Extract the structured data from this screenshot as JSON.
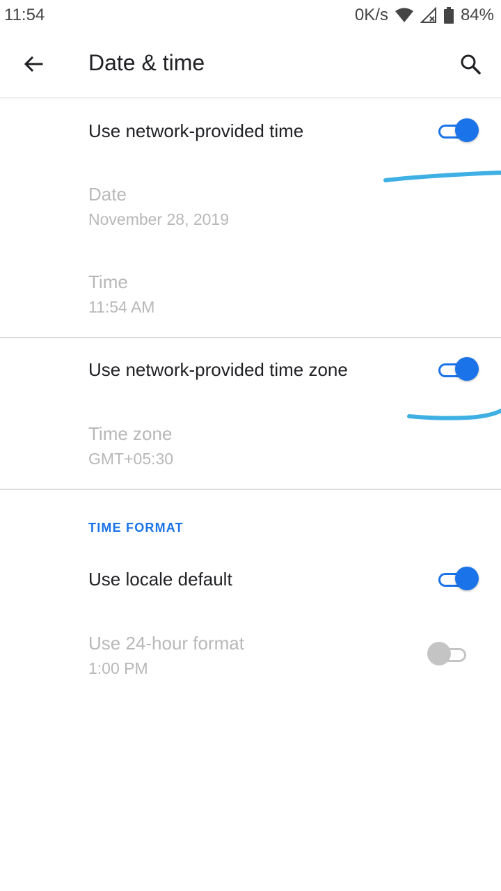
{
  "status_bar": {
    "time": "11:54",
    "speed": "0K/s",
    "battery": "84%",
    "icons": [
      "wifi-icon",
      "cell-signal-no-data-icon",
      "battery-icon"
    ]
  },
  "app_bar": {
    "title": "Date & time",
    "back_icon": "arrow-back-icon",
    "search_icon": "search-icon"
  },
  "settings": {
    "network_time": {
      "title": "Use network-provided time",
      "checked": true
    },
    "date": {
      "title": "Date",
      "value": "November 28, 2019",
      "enabled": false
    },
    "time": {
      "title": "Time",
      "value": "11:54 AM",
      "enabled": false
    },
    "network_timezone": {
      "title": "Use network-provided time zone",
      "checked": true
    },
    "timezone": {
      "title": "Time zone",
      "value": "GMT+05:30",
      "enabled": false
    },
    "time_format_header": "TIME FORMAT",
    "locale_default": {
      "title": "Use locale default",
      "checked": true
    },
    "hour24": {
      "title": "Use 24-hour format",
      "value": "1:00 PM",
      "checked": false,
      "enabled": false
    }
  },
  "colors": {
    "accent": "#1a73e8",
    "disabled_text": "#b8b8b8",
    "annotation_stroke": "#3fb0e4"
  }
}
